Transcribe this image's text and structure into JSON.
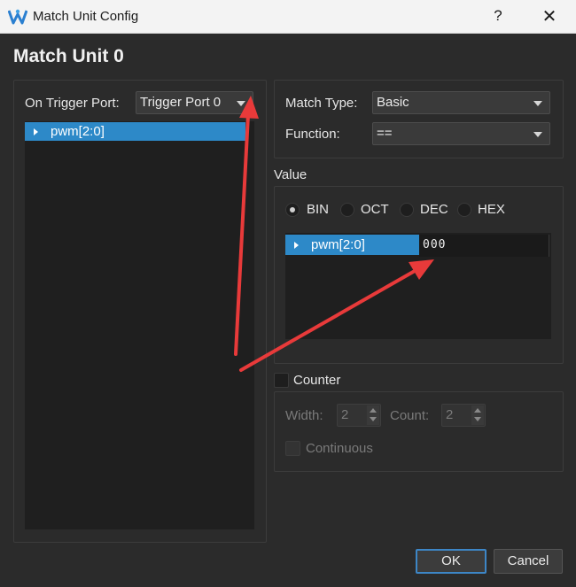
{
  "window": {
    "title": "Match Unit Config",
    "help": "?",
    "close": "✕"
  },
  "heading": "Match Unit 0",
  "trigger": {
    "label": "On Trigger Port:",
    "port_value": "Trigger Port 0",
    "tree_item": "pwm[2:0]"
  },
  "match": {
    "type_label": "Match Type:",
    "type_value": "Basic",
    "function_label": "Function:",
    "function_value": "=="
  },
  "value": {
    "section_label": "Value",
    "radix": [
      {
        "label": "BIN",
        "selected": true
      },
      {
        "label": "OCT",
        "selected": false
      },
      {
        "label": "DEC",
        "selected": false
      },
      {
        "label": "HEX",
        "selected": false
      }
    ],
    "signal": "pwm[2:0]",
    "signal_value": "000"
  },
  "counter": {
    "label": "Counter",
    "enabled": false,
    "width_label": "Width:",
    "width_value": "2",
    "count_label": "Count:",
    "count_value": "2",
    "continuous_label": "Continuous"
  },
  "buttons": {
    "ok": "OK",
    "cancel": "Cancel"
  },
  "colors": {
    "accent": "#2d89c8",
    "annotation_arrow": "#e83a3a",
    "background": "#2b2b2b"
  }
}
